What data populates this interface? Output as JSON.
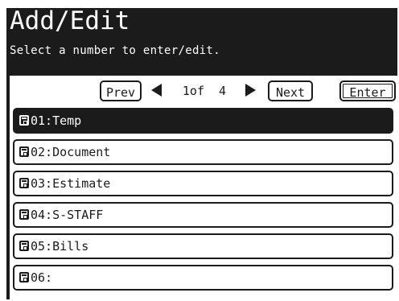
{
  "header": {
    "title": "Add/Edit",
    "subtitle": "Select a number to enter/edit."
  },
  "nav": {
    "prev_label": "Prev",
    "page_text": "1of  4",
    "next_label": "Next",
    "enter_label": "Enter"
  },
  "items": [
    {
      "label": "01:Temp",
      "selected": true,
      "icon": "folder-icon"
    },
    {
      "label": "02:Document",
      "selected": false,
      "icon": "folder-icon"
    },
    {
      "label": "03:Estimate",
      "selected": false,
      "icon": "folder-icon"
    },
    {
      "label": "04:S-STAFF",
      "selected": false,
      "icon": "folder-icon"
    },
    {
      "label": "05:Bills",
      "selected": false,
      "icon": "folder-icon"
    },
    {
      "label": "06:",
      "selected": false,
      "icon": "folder-icon"
    }
  ],
  "colors": {
    "dark": "#1b1b1b",
    "light": "#ffffff"
  }
}
